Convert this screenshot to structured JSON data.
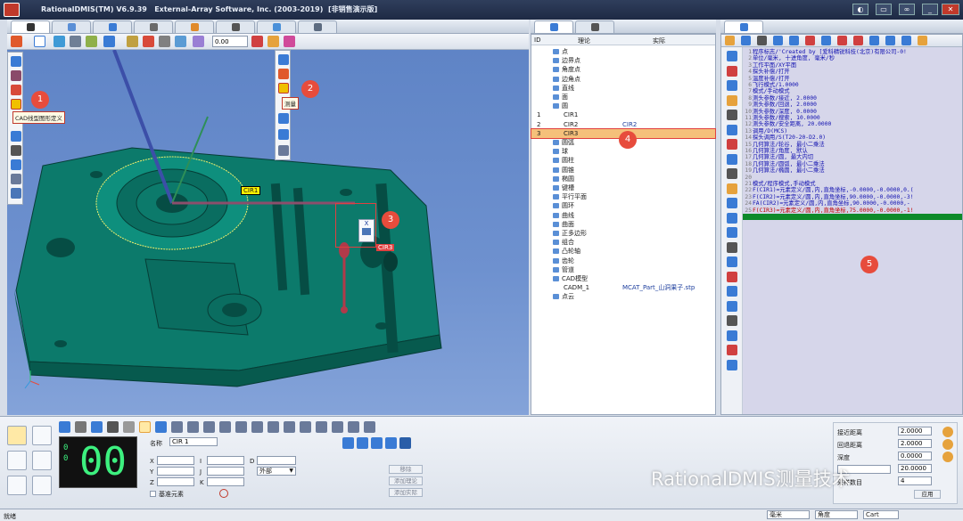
{
  "app": {
    "title": "RationalDMIS(TM) V6.9.39",
    "company": "External-Array Software, Inc. (2003-2019)",
    "edition": "[非销售演示版]"
  },
  "toolbar": {
    "zoom_value": "0.00"
  },
  "viewport": {
    "tooltip1": "CAD线型图形定义",
    "tooltip2": "测量",
    "callouts": [
      "1",
      "2",
      "3",
      "4",
      "5"
    ],
    "labels": {
      "cir1": "CIR1",
      "cir3": "CIR3"
    },
    "popup_x": "X"
  },
  "tree": {
    "header": {
      "id": "ID",
      "theory": "理论",
      "actual": "实际"
    },
    "rows": [
      {
        "id": "",
        "name": "点",
        "actual": ""
      },
      {
        "id": "",
        "name": "边界点",
        "actual": ""
      },
      {
        "id": "",
        "name": "角度点",
        "actual": ""
      },
      {
        "id": "",
        "name": "边角点",
        "actual": ""
      },
      {
        "id": "",
        "name": "直线",
        "actual": ""
      },
      {
        "id": "",
        "name": "面",
        "actual": ""
      },
      {
        "id": "",
        "name": "圆",
        "actual": ""
      },
      {
        "id": "1",
        "name": "CIR1",
        "actual": ""
      },
      {
        "id": "2",
        "name": "CIR2",
        "actual": "CIR2"
      },
      {
        "id": "3",
        "name": "CIR3",
        "actual": ""
      },
      {
        "id": "",
        "name": "圆弧",
        "actual": ""
      },
      {
        "id": "",
        "name": "球",
        "actual": ""
      },
      {
        "id": "",
        "name": "圆柱",
        "actual": ""
      },
      {
        "id": "",
        "name": "圆锥",
        "actual": ""
      },
      {
        "id": "",
        "name": "椭圆",
        "actual": ""
      },
      {
        "id": "",
        "name": "键槽",
        "actual": ""
      },
      {
        "id": "",
        "name": "平行平面",
        "actual": ""
      },
      {
        "id": "",
        "name": "圆环",
        "actual": ""
      },
      {
        "id": "",
        "name": "曲线",
        "actual": ""
      },
      {
        "id": "",
        "name": "曲面",
        "actual": ""
      },
      {
        "id": "",
        "name": "正多边形",
        "actual": ""
      },
      {
        "id": "",
        "name": "组合",
        "actual": ""
      },
      {
        "id": "",
        "name": "凸轮轴",
        "actual": ""
      },
      {
        "id": "",
        "name": "齿轮",
        "actual": ""
      },
      {
        "id": "",
        "name": "管道",
        "actual": ""
      },
      {
        "id": "",
        "name": "CAD模型",
        "actual": ""
      },
      {
        "id": "",
        "name": "CADM_1",
        "actual": "MCAT_Part_山洞果子.stp"
      },
      {
        "id": "",
        "name": "点云",
        "actual": ""
      }
    ]
  },
  "code": {
    "lines": [
      "程序标志/'Created by [爱科精锐科技(北京)有限公司-0!",
      "单位/毫米, 十进角度, 毫米/秒",
      "工作平面/XY平面",
      "探头补偿/打开",
      "温度补偿/打开",
      "飞行模式/1.0000",
      "模式/手动模式",
      "测头参数/接近, 2.0000",
      "测头参数/回退, 2.0000",
      "测头参数/深度, 0.0000",
      "测头参数/搜索, 10.0000",
      "测头参数/安全距离, 20.0000",
      "调用/D(MCS)",
      "探头调用/S(T20-20-D2.0)",
      "几何算法/轮谷, 最小二乘法",
      "几何算法/角度, 默认",
      "几何算法/圆, 最大内切",
      "几何算法/圆弧, 最小二乘法",
      "几何算法/椭圆, 最小二乘法",
      "",
      "模式/程序模式,手动模式",
      "F(CIR1)=元素定义/圆,内,直角坐标,-0.0000,-0.0000,0.(",
      "F(CIR2)=元素定义/圆,内,直角坐标,90.0000,-0.0000,-3!",
      "FA(CIR2)=元素定义/圆,内,直角坐标,90.0000,-0.0000,-",
      "F(CIR3)=元素定义/圆,内,直角坐标,75.0000,-0.0000,-1!"
    ]
  },
  "bottom": {
    "led": "00",
    "name_label": "名称",
    "name_value": "CIR 1",
    "x": "X",
    "y": "Y",
    "z": "Z",
    "i": "I",
    "j": "J",
    "k": "K",
    "d": "D",
    "inner_outer": "外部",
    "btn_remove": "移除",
    "btn_add_theory": "添加理论",
    "btn_add_actual": "添加实际",
    "datum_checkbox": "基准元素",
    "approach_label": "接近距离",
    "approach_value": "2.0000",
    "retract_label": "回退距离",
    "retract_value": "2.0000",
    "depth_label": "深度",
    "depth_value": "0.0000",
    "search_value": "20.0000",
    "sample_label": "采样数目",
    "sample_value": "4",
    "apply": "应用"
  },
  "status": {
    "left": "就绪",
    "unit": "毫米",
    "angle": "角度",
    "coord": "Cart"
  },
  "watermark": "RationalDMIS测量技术"
}
